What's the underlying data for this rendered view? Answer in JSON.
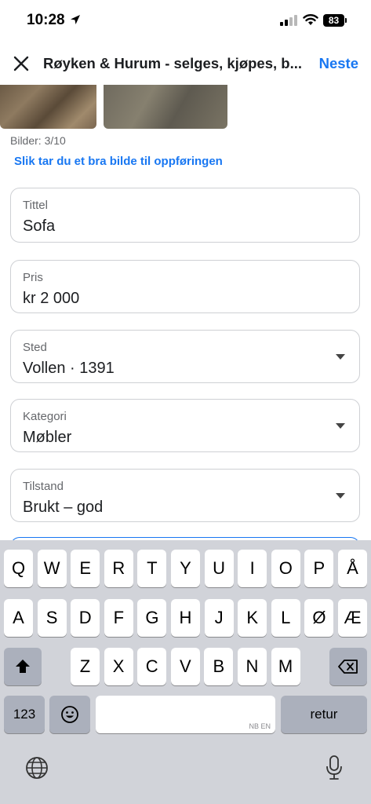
{
  "status": {
    "time": "10:28",
    "battery": "83"
  },
  "header": {
    "title": "Røyken & Hurum - selges, kjøpes, b...",
    "next_label": "Neste"
  },
  "photos": {
    "count_label": "Bilder: 3/10",
    "tip_link": "Slik tar du et bra bilde til oppføringen"
  },
  "fields": {
    "title": {
      "label": "Tittel",
      "value": "Sofa"
    },
    "price": {
      "label": "Pris",
      "value": "kr 2 000"
    },
    "place": {
      "label": "Sted",
      "value": "Vollen · 1391"
    },
    "category": {
      "label": "Kategori",
      "value": "Møbler"
    },
    "condition": {
      "label": "Tilstand",
      "value": "Brukt – god"
    }
  },
  "keyboard": {
    "row1": [
      "Q",
      "W",
      "E",
      "R",
      "T",
      "Y",
      "U",
      "I",
      "O",
      "P",
      "Å"
    ],
    "row2": [
      "A",
      "S",
      "D",
      "F",
      "G",
      "H",
      "J",
      "K",
      "L",
      "Ø",
      "Æ"
    ],
    "row3": [
      "Z",
      "X",
      "C",
      "V",
      "B",
      "N",
      "M"
    ],
    "numbers_label": "123",
    "space_lang": "NB EN",
    "return_label": "retur"
  },
  "colors": {
    "accent": "#1877f2",
    "keyboard_bg": "#d1d3d9",
    "dark_key": "#abb0bc"
  }
}
